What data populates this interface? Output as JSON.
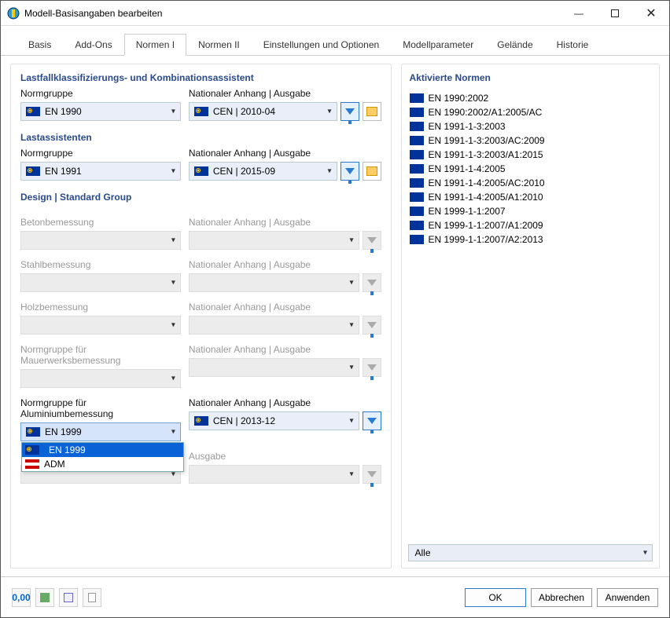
{
  "window": {
    "title": "Modell-Basisangaben bearbeiten"
  },
  "tabs": [
    "Basis",
    "Add-Ons",
    "Normen I",
    "Normen II",
    "Einstellungen und Optionen",
    "Modellparameter",
    "Gelände",
    "Historie"
  ],
  "active_tab": 2,
  "section1": {
    "title": "Lastfallklassifizierungs- und Kombinationsassistent",
    "group_label": "Normgruppe",
    "group_value": "EN 1990",
    "annex_label": "Nationaler Anhang | Ausgabe",
    "annex_value": "CEN | 2010-04"
  },
  "section2": {
    "title": "Lastassistenten",
    "group_label": "Normgruppe",
    "group_value": "EN 1991",
    "annex_label": "Nationaler Anhang | Ausgabe",
    "annex_value": "CEN | 2015-09"
  },
  "design": {
    "title": "Design | Standard Group",
    "rows": [
      {
        "label": "Betonbemessung",
        "annex": "Nationaler Anhang | Ausgabe"
      },
      {
        "label": "Stahlbemessung",
        "annex": "Nationaler Anhang | Ausgabe"
      },
      {
        "label": "Holzbemessung",
        "annex": "Nationaler Anhang | Ausgabe"
      },
      {
        "label": "Normgruppe für Mauerwerksbemessung",
        "annex": "Nationaler Anhang | Ausgabe"
      }
    ],
    "alum": {
      "label": "Normgruppe für Aluminiumbemessung",
      "value": "EN 1999",
      "annex_label": "Nationaler Anhang | Ausgabe",
      "annex_value": "CEN | 2013-12",
      "options": [
        "EN 1999",
        "ADM"
      ]
    },
    "extra": {
      "annex_label": "Ausgabe"
    }
  },
  "right_panel": {
    "title": "Aktivierte Normen",
    "standards": [
      "EN 1990:2002",
      "EN 1990:2002/A1:2005/AC",
      "EN 1991-1-3:2003",
      "EN 1991-1-3:2003/AC:2009",
      "EN 1991-1-3:2003/A1:2015",
      "EN 1991-1-4:2005",
      "EN 1991-1-4:2005/AC:2010",
      "EN 1991-1-4:2005/A1:2010",
      "EN 1999-1-1:2007",
      "EN 1999-1-1:2007/A1:2009",
      "EN 1999-1-1:2007/A2:2013"
    ],
    "filter": "Alle"
  },
  "footer": {
    "ok": "OK",
    "cancel": "Abbrechen",
    "apply": "Anwenden",
    "tool1": "0,00"
  }
}
